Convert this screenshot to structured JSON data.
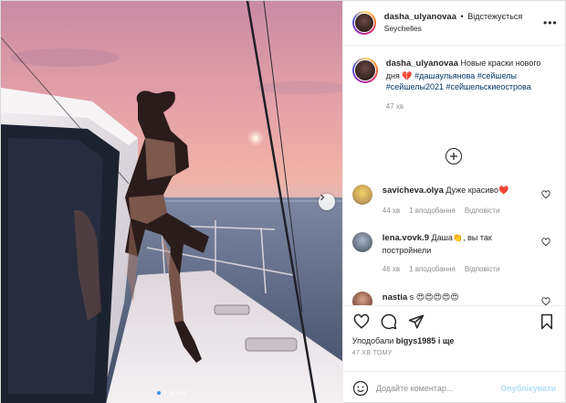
{
  "post": {
    "username": "dasha_ulyanovaa",
    "separator": "•",
    "follow_label": "Відстежується",
    "location": "Seychelles",
    "more_icon": "ellipsis-icon",
    "image_carousel": {
      "slide_count": 5,
      "active_slide": 1,
      "next_icon": "chevron-right-icon"
    }
  },
  "caption": {
    "username": "dasha_ulyanovaa",
    "text": "Новые краски нового дня",
    "emoji": "💔",
    "hashtags": [
      "#дашаульянова",
      "#сейшелы",
      "#сейшелы2021",
      "#сейшельскиеострова"
    ],
    "time": "47 хв"
  },
  "load_more_icon": "plus-circle-icon",
  "comments": [
    {
      "username": "savicheva.olya",
      "text": "Дуже красиво",
      "emoji": "❤️",
      "time": "44 хв",
      "likes": "1 вподобання",
      "reply": "Відповісти"
    },
    {
      "username": "lena.vovk.9",
      "text": "Даша",
      "emoji": "👏",
      "text2": ", вы так постройнели",
      "time": "46 хв",
      "likes": "1 вподобання",
      "reply": "Відповісти"
    },
    {
      "username": "nastia",
      "text": "s",
      "emoji": "😍😍😍😍😍"
    }
  ],
  "actions": {
    "like_icon": "heart-icon",
    "comment_icon": "comment-icon",
    "share_icon": "share-icon",
    "save_icon": "bookmark-icon",
    "liked_by_prefix": "Уподобали",
    "liked_by_user": "bigys1985",
    "liked_by_suffix": "і ще",
    "timestamp": "47 ХВ ТОМУ"
  },
  "add_comment": {
    "emoji_icon": "smiley-icon",
    "placeholder": "Додайте коментар...",
    "publish_label": "Опублікувати"
  },
  "colors": {
    "link": "#00376b",
    "publish_disabled": "#b2dffc",
    "active_dot": "#3897f0",
    "secondary_text": "#8e8e8e"
  }
}
